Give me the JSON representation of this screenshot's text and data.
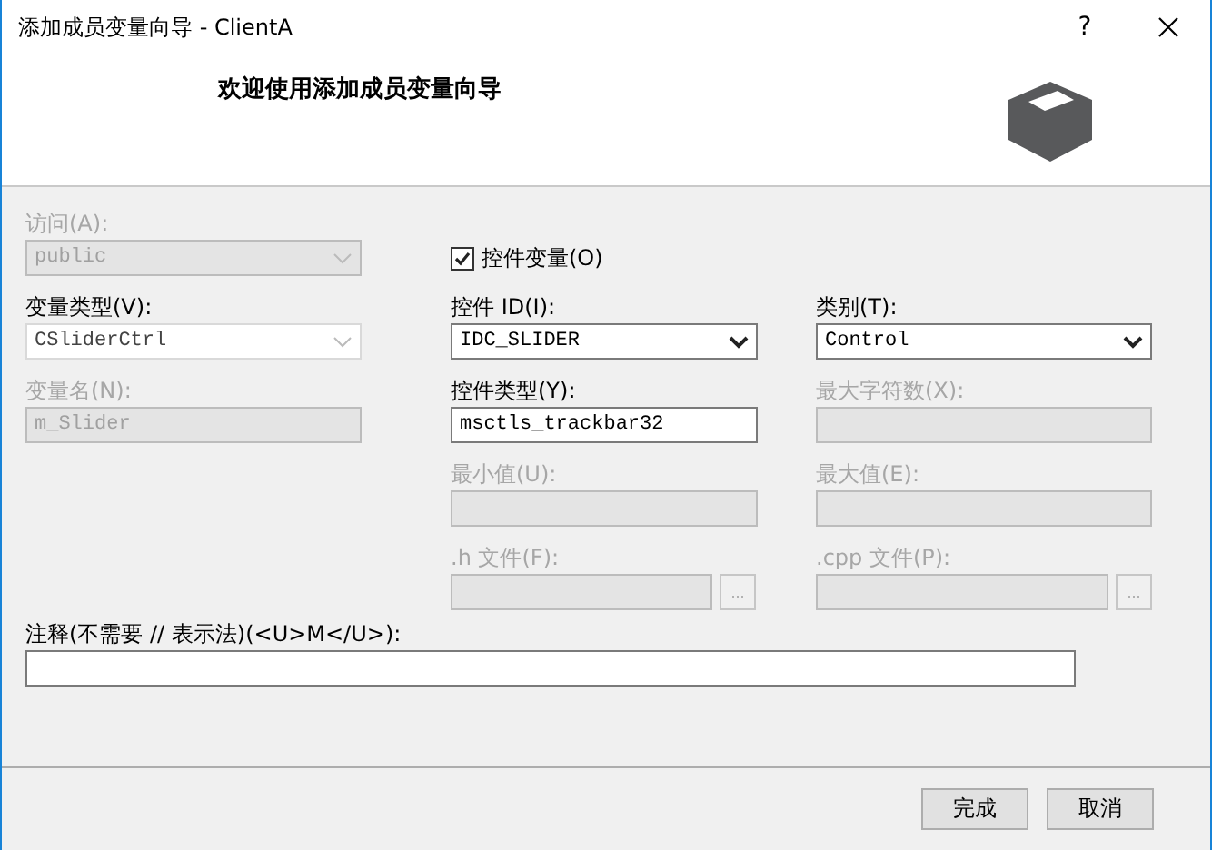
{
  "window": {
    "title": "添加成员变量向导 - ClientA",
    "help": "?"
  },
  "header": {
    "heading": "欢迎使用添加成员变量向导"
  },
  "columns": [
    {
      "fields": [
        {
          "kind": "dropdown",
          "label": "访问(A):",
          "value": "public",
          "disabled": true
        },
        {
          "kind": "combo",
          "label": "变量类型(V):",
          "value": "CSliderCtrl",
          "disabled": false
        },
        {
          "kind": "text",
          "label": "变量名(N):",
          "value": "m_Slider",
          "disabled": true
        }
      ]
    },
    {
      "fields": [
        {
          "kind": "checkbox",
          "label": "控件变量(O)",
          "checked": true,
          "disabled": false
        },
        {
          "kind": "dropdown",
          "label": "控件 ID(I):",
          "value": "IDC_SLIDER",
          "disabled": false
        },
        {
          "kind": "text",
          "label": "控件类型(Y):",
          "value": "msctls_trackbar32",
          "disabled": false
        },
        {
          "kind": "text",
          "label": "最小值(U):",
          "disabled": true
        },
        {
          "kind": "file",
          "label": ".h 文件(F):",
          "browse": "...",
          "disabled": true
        }
      ]
    },
    {
      "fields": [
        {
          "kind": "dropdown",
          "label": "类别(T):",
          "value": "Control",
          "disabled": false
        },
        {
          "kind": "text",
          "label": "最大字符数(X):",
          "disabled": true
        },
        {
          "kind": "text",
          "label": "最大值(E):",
          "disabled": true
        },
        {
          "kind": "file",
          "label": ".cpp 文件(P):",
          "browse": "...",
          "disabled": true
        }
      ]
    }
  ],
  "comment": {
    "label": "注释(不需要 // 表示法)(<U>M</U>):"
  },
  "buttons": [
    "完成",
    "取消"
  ]
}
